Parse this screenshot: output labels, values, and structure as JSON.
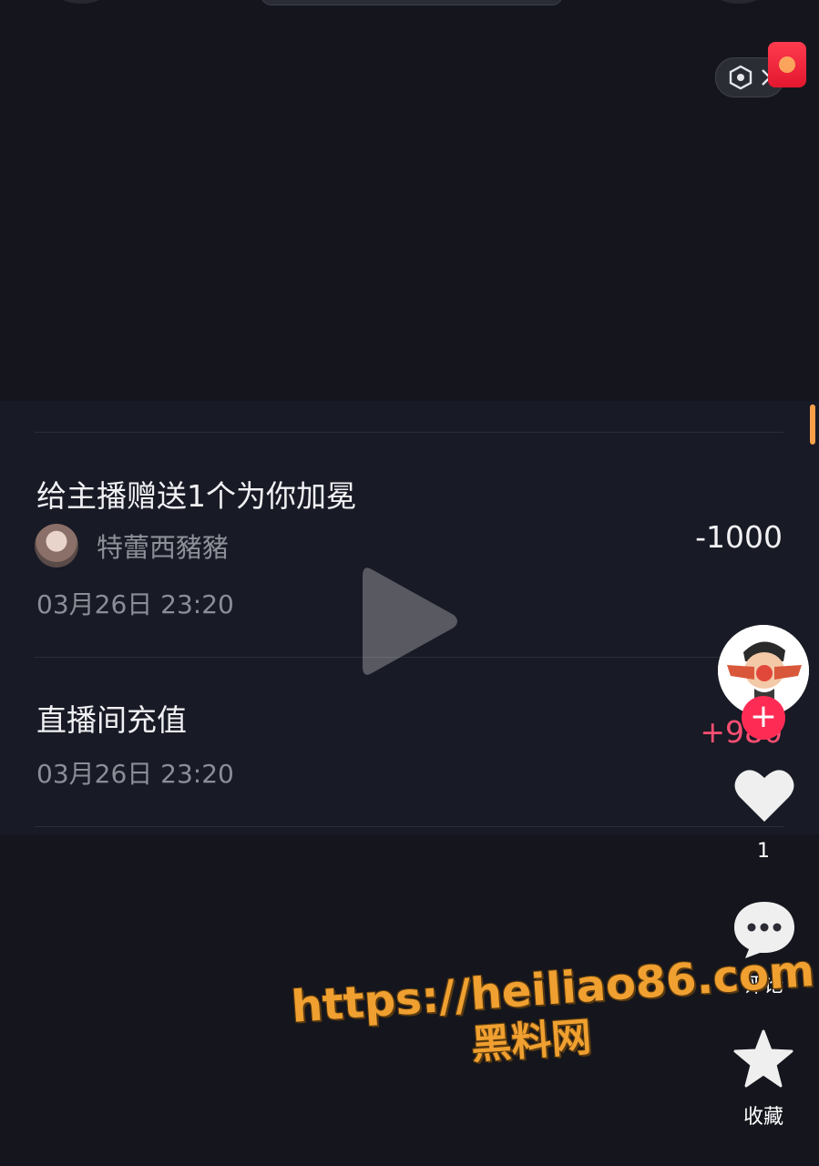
{
  "transactions": [
    {
      "title": "给主播赠送1个为你加冕",
      "username": "特蕾西豬豬",
      "amount": "-1000",
      "time": "03月26日 23:20"
    },
    {
      "title": "直播间充值",
      "amount": "+980",
      "time": "03月26日 23:20"
    }
  ],
  "sidebar": {
    "like_count": "1",
    "comment_label": "评论",
    "favorite_label": "收藏"
  },
  "watermark": {
    "url": "https://heiliao86.com",
    "name": "黑料网"
  },
  "colors": {
    "accent_pink": "#fe2c55",
    "positive_amount": "#ff4f72",
    "background": "#15161d",
    "watermark": "#f0a030"
  }
}
